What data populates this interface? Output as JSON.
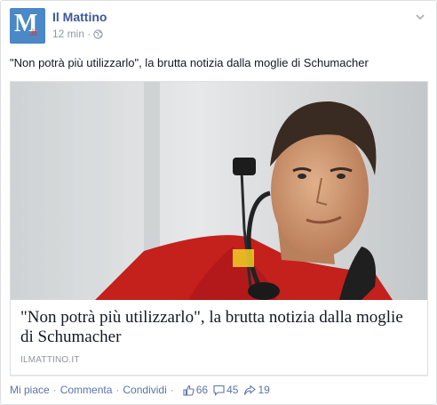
{
  "post": {
    "page_name": "Il Mattino",
    "logo_letter": "M",
    "logo_suffix": ".it",
    "timestamp": "12 min",
    "separator": "·",
    "text": "\"Non potrà più utilizzarlo\", la brutta notizia dalla moglie di Schumacher"
  },
  "link": {
    "title": "\"Non potrà più utilizzarlo\", la brutta notizia dalla moglie di Schumacher",
    "domain": "ILMATTINO.IT"
  },
  "actions": {
    "like": "Mi piace",
    "comment": "Commenta",
    "share": "Condividi",
    "separator": "·",
    "likes_count": "66",
    "comments_count": "45",
    "shares_count": "19"
  },
  "colors": {
    "link_blue": "#3b5998",
    "logo_blue": "#4a88c8",
    "logo_red": "#e03a2f",
    "meta_gray": "#9197a3"
  },
  "icons": [
    "globe-icon",
    "chevron-down-icon",
    "thumbs-up-icon",
    "comment-icon",
    "share-icon"
  ]
}
